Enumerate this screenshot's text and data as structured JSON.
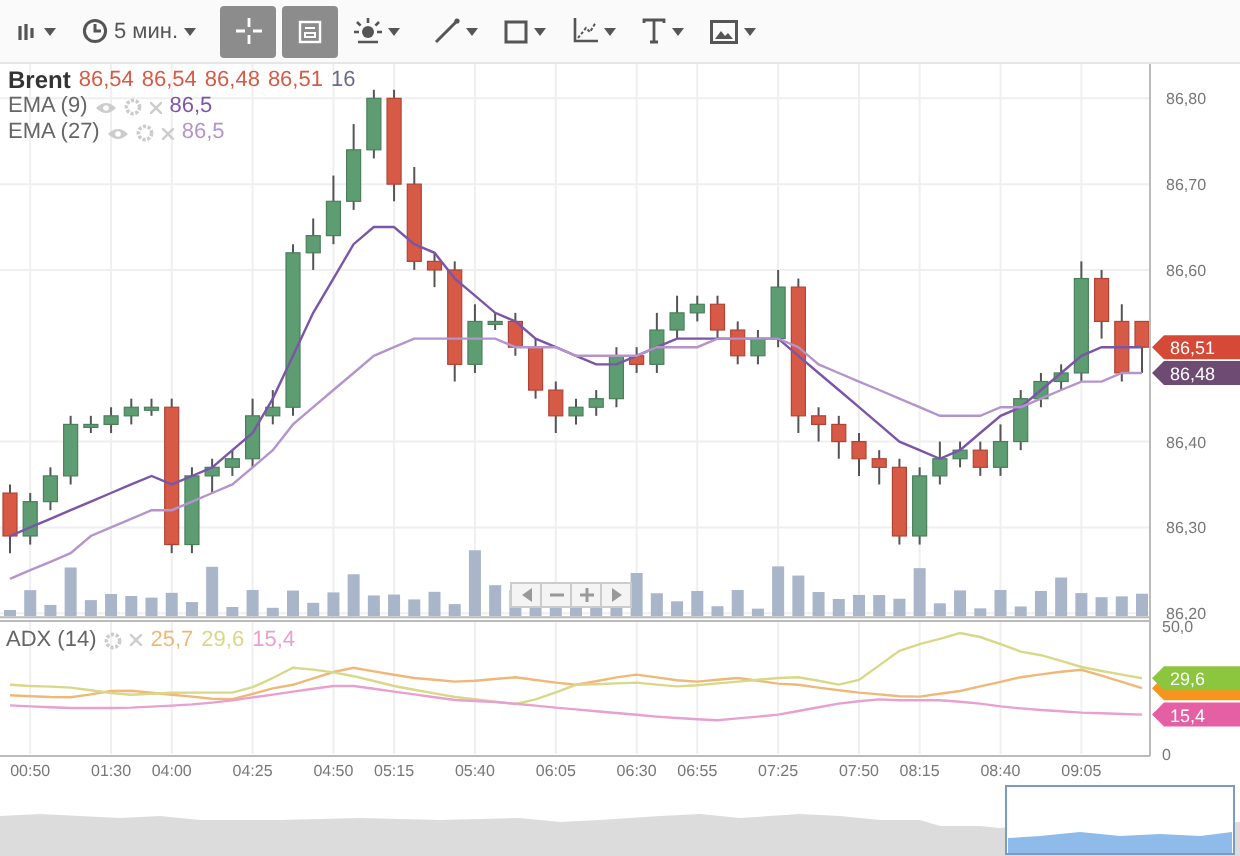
{
  "toolbar": [
    {
      "kind": "chart-type",
      "selected": false,
      "dropdown": true
    },
    {
      "kind": "interval",
      "label": "5 мин.",
      "selected": false,
      "dropdown": true
    },
    {
      "kind": "crosshair",
      "selected": true,
      "dropdown": false
    },
    {
      "kind": "frame",
      "selected": true,
      "dropdown": false
    },
    {
      "kind": "brightness",
      "selected": false,
      "dropdown": true
    },
    {
      "kind": "line",
      "selected": false,
      "dropdown": true
    },
    {
      "kind": "shape",
      "selected": false,
      "dropdown": true
    },
    {
      "kind": "axes",
      "selected": false,
      "dropdown": true
    },
    {
      "kind": "text",
      "selected": false,
      "dropdown": true
    },
    {
      "kind": "image",
      "selected": false,
      "dropdown": true
    }
  ],
  "main": {
    "legend": {
      "values": [
        "86,54",
        "86,54",
        "86,48",
        "86,51"
      ],
      "volume": "16",
      "indicator_values": [
        "86,5",
        "86,5"
      ]
    },
    "chart_data": {
      "type": "candlestick",
      "title": "Brent",
      "grid": true,
      "ylim": [
        86.2,
        86.84
      ],
      "ohlc": [
        [
          86.34,
          86.35,
          86.27,
          86.29
        ],
        [
          86.29,
          86.34,
          86.28,
          86.33
        ],
        [
          86.33,
          86.37,
          86.32,
          86.36
        ],
        [
          86.36,
          86.43,
          86.35,
          86.42
        ],
        [
          86.42,
          86.43,
          86.41,
          86.42
        ],
        [
          86.42,
          86.44,
          86.41,
          86.43
        ],
        [
          86.43,
          86.45,
          86.42,
          86.44
        ],
        [
          86.44,
          86.45,
          86.43,
          86.44
        ],
        [
          86.44,
          86.45,
          86.27,
          86.28
        ],
        [
          86.28,
          86.37,
          86.27,
          86.36
        ],
        [
          86.36,
          86.38,
          86.34,
          86.37
        ],
        [
          86.37,
          86.39,
          86.36,
          86.38
        ],
        [
          86.38,
          86.45,
          86.37,
          86.43
        ],
        [
          86.43,
          86.46,
          86.42,
          86.44
        ],
        [
          86.44,
          86.63,
          86.43,
          86.62
        ],
        [
          86.62,
          86.66,
          86.6,
          86.64
        ],
        [
          86.64,
          86.71,
          86.63,
          86.68
        ],
        [
          86.68,
          86.77,
          86.67,
          86.74
        ],
        [
          86.74,
          86.81,
          86.73,
          86.8
        ],
        [
          86.8,
          86.81,
          86.68,
          86.7
        ],
        [
          86.7,
          86.72,
          86.6,
          86.61
        ],
        [
          86.61,
          86.62,
          86.58,
          86.6
        ],
        [
          86.6,
          86.61,
          86.47,
          86.49
        ],
        [
          86.49,
          86.56,
          86.48,
          86.54
        ],
        [
          86.54,
          86.55,
          86.53,
          86.54
        ],
        [
          86.54,
          86.55,
          86.5,
          86.51
        ],
        [
          86.51,
          86.52,
          86.45,
          86.46
        ],
        [
          86.46,
          86.47,
          86.41,
          86.43
        ],
        [
          86.43,
          86.45,
          86.42,
          86.44
        ],
        [
          86.44,
          86.46,
          86.43,
          86.45
        ],
        [
          86.45,
          86.51,
          86.44,
          86.5
        ],
        [
          86.5,
          86.51,
          86.48,
          86.49
        ],
        [
          86.49,
          86.55,
          86.48,
          86.53
        ],
        [
          86.53,
          86.57,
          86.52,
          86.55
        ],
        [
          86.55,
          86.57,
          86.54,
          86.56
        ],
        [
          86.56,
          86.57,
          86.52,
          86.53
        ],
        [
          86.53,
          86.54,
          86.49,
          86.5
        ],
        [
          86.5,
          86.53,
          86.49,
          86.52
        ],
        [
          86.52,
          86.6,
          86.51,
          86.58
        ],
        [
          86.58,
          86.59,
          86.41,
          86.43
        ],
        [
          86.43,
          86.44,
          86.4,
          86.42
        ],
        [
          86.42,
          86.43,
          86.38,
          86.4
        ],
        [
          86.4,
          86.41,
          86.36,
          86.38
        ],
        [
          86.38,
          86.39,
          86.35,
          86.37
        ],
        [
          86.37,
          86.38,
          86.28,
          86.29
        ],
        [
          86.29,
          86.37,
          86.28,
          86.36
        ],
        [
          86.36,
          86.4,
          86.35,
          86.38
        ],
        [
          86.38,
          86.4,
          86.37,
          86.39
        ],
        [
          86.39,
          86.4,
          86.36,
          86.37
        ],
        [
          86.37,
          86.42,
          86.36,
          86.4
        ],
        [
          86.4,
          86.46,
          86.39,
          86.45
        ],
        [
          86.45,
          86.48,
          86.44,
          86.47
        ],
        [
          86.47,
          86.49,
          86.46,
          86.48
        ],
        [
          86.48,
          86.61,
          86.47,
          86.59
        ],
        [
          86.59,
          86.6,
          86.52,
          86.54
        ],
        [
          86.54,
          86.56,
          86.47,
          86.48
        ],
        [
          86.54,
          86.54,
          86.48,
          86.51
        ]
      ],
      "series": [
        {
          "name": "EMA (9)",
          "type": "line",
          "color": "#7b55a8",
          "values": [
            86.29,
            86.3,
            86.31,
            86.32,
            86.33,
            86.34,
            86.35,
            86.36,
            86.35,
            86.36,
            86.37,
            86.39,
            86.41,
            86.45,
            86.5,
            86.55,
            86.59,
            86.63,
            86.65,
            86.65,
            86.63,
            86.62,
            86.59,
            86.57,
            86.55,
            86.54,
            86.52,
            86.51,
            86.5,
            86.49,
            86.49,
            86.5,
            86.51,
            86.52,
            86.52,
            86.52,
            86.52,
            86.52,
            86.52,
            86.5,
            86.48,
            86.46,
            86.44,
            86.42,
            86.4,
            86.39,
            86.38,
            86.39,
            86.41,
            86.43,
            86.44,
            86.46,
            86.48,
            86.5,
            86.51,
            86.51,
            86.51
          ]
        },
        {
          "name": "EMA (27)",
          "type": "line",
          "color": "#b494cc",
          "values": [
            86.24,
            86.25,
            86.26,
            86.27,
            86.29,
            86.3,
            86.31,
            86.32,
            86.32,
            86.33,
            86.34,
            86.35,
            86.37,
            86.39,
            86.42,
            86.44,
            86.46,
            86.48,
            86.5,
            86.51,
            86.52,
            86.52,
            86.52,
            86.52,
            86.52,
            86.51,
            86.51,
            86.51,
            86.5,
            86.5,
            86.5,
            86.5,
            86.51,
            86.51,
            86.51,
            86.52,
            86.52,
            86.52,
            86.52,
            86.51,
            86.49,
            86.48,
            86.47,
            86.46,
            86.45,
            86.44,
            86.43,
            86.43,
            86.43,
            86.44,
            86.44,
            86.45,
            86.46,
            86.47,
            86.47,
            86.48,
            86.48
          ]
        }
      ],
      "yticks": [
        {
          "value": 86.2,
          "label": "86,20"
        },
        {
          "value": 86.3,
          "label": "86,30"
        },
        {
          "value": 86.4,
          "label": "86,40"
        },
        {
          "value": 86.6,
          "label": "86,60"
        },
        {
          "value": 86.7,
          "label": "86,70"
        },
        {
          "value": 86.8,
          "label": "86,80"
        }
      ],
      "annotations": [
        "86,51",
        "86,48"
      ]
    }
  },
  "adx": {
    "legend": {
      "values": [
        "25,7",
        "29,6",
        "15,4"
      ]
    },
    "chart_data": {
      "type": "line",
      "title": "ADX (14)",
      "grid": true,
      "ylim": [
        0,
        50
      ],
      "categories": [
        null,
        "00:50",
        null,
        null,
        null,
        "01:30",
        null,
        null,
        "04:00",
        null,
        null,
        null,
        "04:25",
        null,
        null,
        null,
        "04:50",
        null,
        null,
        "05:15",
        null,
        null,
        null,
        "05:40",
        null,
        null,
        null,
        "06:05",
        null,
        null,
        null,
        "06:30",
        null,
        null,
        "06:55",
        null,
        null,
        null,
        "07:25",
        null,
        null,
        null,
        "07:50",
        null,
        null,
        "08:15",
        null,
        null,
        null,
        "08:40",
        null,
        null,
        null,
        "09:05",
        null,
        null,
        null
      ],
      "series": [
        {
          "color": "#f0b878",
          "values": [
            23,
            22.6,
            22.3,
            22.2,
            23.3,
            24.6,
            24.7,
            23.9,
            23.1,
            22.4,
            21.6,
            21.4,
            23.5,
            25.6,
            27,
            29.5,
            32,
            33.7,
            32.3,
            30.9,
            29.7,
            29,
            28.3,
            28.6,
            29.3,
            30,
            28.9,
            27.9,
            27,
            28.4,
            29.9,
            31,
            29.9,
            28.8,
            28.3,
            29,
            29.7,
            28.6,
            27.5,
            27,
            25.9,
            24.9,
            24,
            23.3,
            22.6,
            22.4,
            23.5,
            24.6,
            26.4,
            28.2,
            30,
            31.1,
            32.1,
            32.9,
            30.6,
            28.2,
            25.7
          ]
        },
        {
          "color": "#d8d888",
          "values": [
            27,
            26.6,
            26.3,
            25.9,
            24.9,
            23.8,
            23.1,
            23.5,
            23.9,
            24,
            24,
            24,
            26.1,
            29.7,
            33.7,
            33,
            31.9,
            30.4,
            28.5,
            26.6,
            25.1,
            23.7,
            22.3,
            21.4,
            20.4,
            19.5,
            21.3,
            24.1,
            27,
            27.3,
            27.6,
            27.9,
            27.1,
            26.4,
            26.9,
            27.6,
            28.3,
            29,
            29.7,
            30,
            28.6,
            27.1,
            28.9,
            34.6,
            40.3,
            42.9,
            45,
            47.3,
            45.7,
            42.9,
            40,
            38.6,
            36.4,
            34,
            32.4,
            31,
            29.6
          ]
        },
        {
          "color": "#e8a0d0",
          "values": [
            19,
            18.6,
            18.3,
            18,
            18,
            18,
            18.1,
            18.5,
            18.9,
            19.4,
            20.1,
            20.9,
            22.1,
            23.2,
            24.4,
            25.5,
            26.6,
            26.6,
            25.5,
            24.4,
            23.3,
            22.2,
            21.1,
            20.7,
            20.3,
            19.6,
            18.9,
            18.1,
            17.4,
            16.7,
            16,
            15.3,
            14.6,
            14.1,
            13.6,
            13.2,
            13.9,
            14.6,
            15.4,
            16.8,
            18.3,
            19.7,
            20.6,
            21.3,
            21,
            21,
            21,
            20.4,
            19.7,
            18.6,
            17.8,
            17.2,
            16.7,
            16.2,
            15.9,
            15.6,
            15.4
          ]
        }
      ],
      "yticks": [
        {
          "value": 0,
          "label": "0"
        },
        {
          "value": 50,
          "label": "50,0"
        }
      ],
      "annotations": [
        "29,6",
        "15,4"
      ]
    }
  }
}
